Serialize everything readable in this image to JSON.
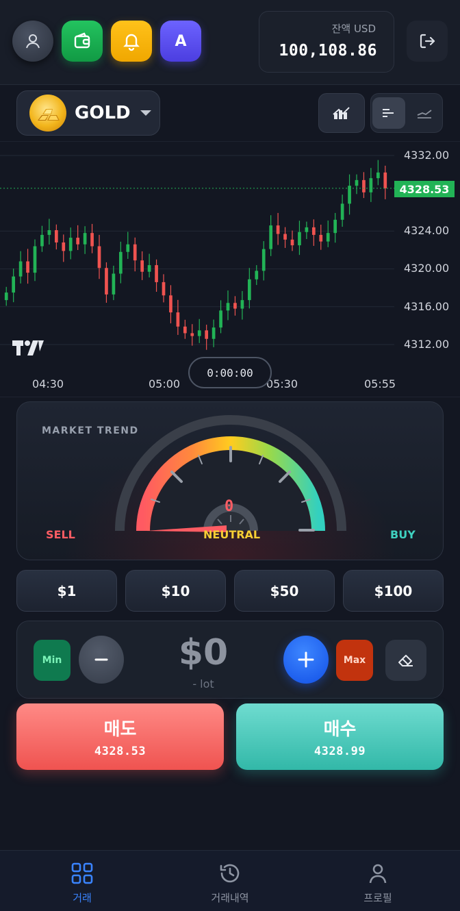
{
  "header": {
    "avatar_letter": "A",
    "balance_label": "잔액 USD",
    "balance_value": "100,108.86"
  },
  "symbol": {
    "name": "GOLD"
  },
  "chart": {
    "current_price": "4328.53",
    "y_labels": [
      "4332.00",
      "4324.00",
      "4320.00",
      "4316.00",
      "4312.00"
    ],
    "x_labels": [
      "04:30",
      "05:00",
      "05:30",
      "05:55"
    ],
    "timer": "0:00:00",
    "colors": {
      "up": "#22b356",
      "down": "#ef5350",
      "price_line": "#22b356"
    }
  },
  "chart_data": {
    "type": "candlestick",
    "y_ticks": [
      4312,
      4316,
      4320,
      4324,
      4332
    ],
    "ylim": [
      4308.5,
      4333.5
    ],
    "x_ticks": [
      "04:30",
      "05:00",
      "05:30",
      "05:55"
    ],
    "last_price": 4328.53,
    "closes": [
      4317.5,
      4319.2,
      4320.8,
      4319.6,
      4322.4,
      4323.6,
      4324.1,
      4322.8,
      4321.9,
      4323.3,
      4322.6,
      4323.8,
      4322.4,
      4320.1,
      4317.3,
      4319.5,
      4321.8,
      4322.6,
      4320.9,
      4319.7,
      4320.4,
      4318.6,
      4317.2,
      4315.4,
      4313.9,
      4313.2,
      4312.9,
      4313.5,
      4312.6,
      4313.8,
      4315.6,
      4316.4,
      4315.8,
      4316.7,
      4318.9,
      4319.8,
      4322.1,
      4324.6,
      4323.7,
      4323.1,
      4322.5,
      4323.9,
      4324.4,
      4323.6,
      4322.9,
      4323.8,
      4325.2,
      4326.9,
      4328.8,
      4329.4,
      4328.1,
      4329.6,
      4330.2,
      4328.53
    ]
  },
  "trend": {
    "title": "MARKET TREND",
    "value": "0",
    "sell_label": "SELL",
    "neutral_label": "NEUTRAL",
    "buy_label": "BUY",
    "level": 0
  },
  "amounts": [
    "$1",
    "$10",
    "$50",
    "$100"
  ],
  "stepper": {
    "min_label": "Min",
    "max_label": "Max",
    "amount": "$0",
    "lot": "- lot"
  },
  "trade": {
    "sell_label": "매도",
    "sell_price": "4328.53",
    "buy_label": "매수",
    "buy_price": "4328.99"
  },
  "nav": [
    {
      "label": "거래",
      "icon": "grid-icon"
    },
    {
      "label": "거래내역",
      "icon": "history-icon"
    },
    {
      "label": "프로필",
      "icon": "user-icon"
    }
  ]
}
